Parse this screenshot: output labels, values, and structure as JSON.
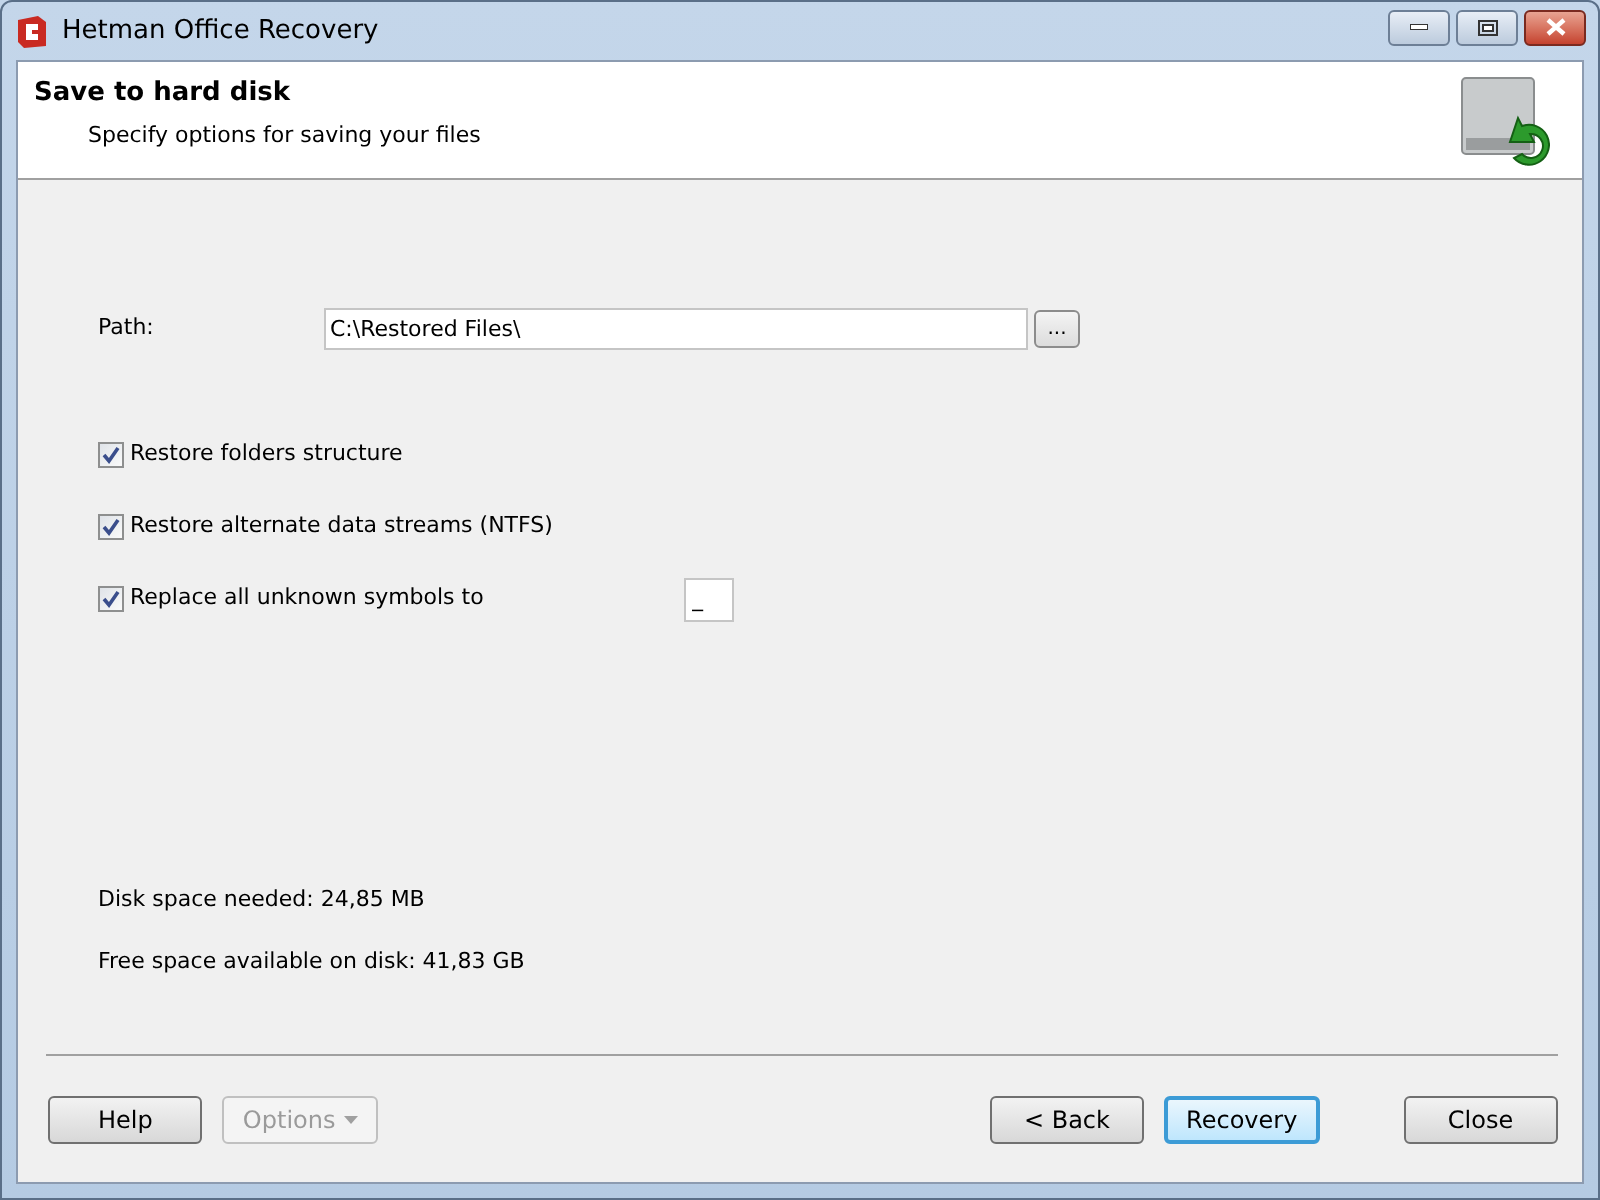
{
  "window": {
    "title": "Hetman Office Recovery"
  },
  "header": {
    "title": "Save to hard disk",
    "subtitle": "Specify options for saving your files"
  },
  "path": {
    "label": "Path:",
    "value": "C:\\Restored Files\\",
    "browse": "..."
  },
  "options": [
    {
      "label": "Restore folders structure",
      "checked": true
    },
    {
      "label": "Restore alternate data streams (NTFS)",
      "checked": true
    },
    {
      "label": "Replace all unknown symbols to",
      "checked": true,
      "value": "_"
    }
  ],
  "disk_info": [
    "Disk space needed: 24,85 MB",
    "Free space available on disk: 41,83 GB"
  ],
  "buttons": [
    {
      "label": "Help",
      "kind": "push",
      "disabled": false,
      "default": false
    },
    {
      "label": "Options",
      "kind": "dropdown",
      "disabled": true,
      "default": false
    },
    {
      "label": "< Back",
      "kind": "push",
      "disabled": false,
      "default": false
    },
    {
      "label": "Recovery",
      "kind": "push",
      "disabled": false,
      "default": true
    },
    {
      "label": "Close",
      "kind": "push",
      "disabled": false,
      "default": false
    }
  ]
}
